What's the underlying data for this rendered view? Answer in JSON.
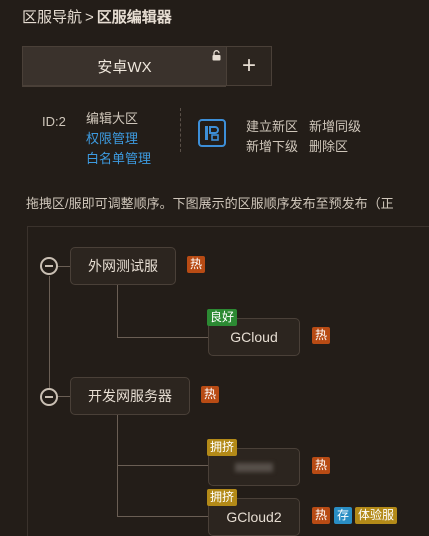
{
  "breadcrumb": {
    "root": "区服导航",
    "separator": ">",
    "current": "区服编辑器"
  },
  "tabs": {
    "active_label": "安卓WX",
    "add_label": "+"
  },
  "info": {
    "zone_id": "ID:2",
    "links": [
      "编辑大区",
      "权限管理",
      "白名单管理"
    ],
    "actions": [
      "建立新区",
      "新增同级",
      "新增下级",
      "删除区"
    ]
  },
  "hint": "拖拽区/服即可调整顺序。下图展示的区服顺序发布至预发布（正",
  "tree": {
    "groups": [
      {
        "name": "外网测试服",
        "tags": [
          "热"
        ],
        "servers": [
          {
            "name": "GCloud",
            "status": "良好",
            "tags": [
              "热"
            ]
          }
        ]
      },
      {
        "name": "开发网服务器",
        "tags": [
          "热"
        ],
        "servers": [
          {
            "name": "",
            "status": "拥挤",
            "tags": [
              "热"
            ]
          },
          {
            "name": "GCloud2",
            "status": "拥挤",
            "tags": [
              "热",
              "存",
              "体验服"
            ]
          }
        ]
      }
    ]
  },
  "colors": {
    "background": "#231d18",
    "link_blue": "#3d9be0",
    "tag_hot": "#b84b14",
    "tag_good": "#2c8a33",
    "tag_crowded": "#b38a18",
    "tag_store": "#2a8ec4"
  },
  "icons": {
    "tab_lock": "lock-icon",
    "add": "plus-icon",
    "edit": "server-edit-icon",
    "collapse": "minus-circle-icon"
  }
}
